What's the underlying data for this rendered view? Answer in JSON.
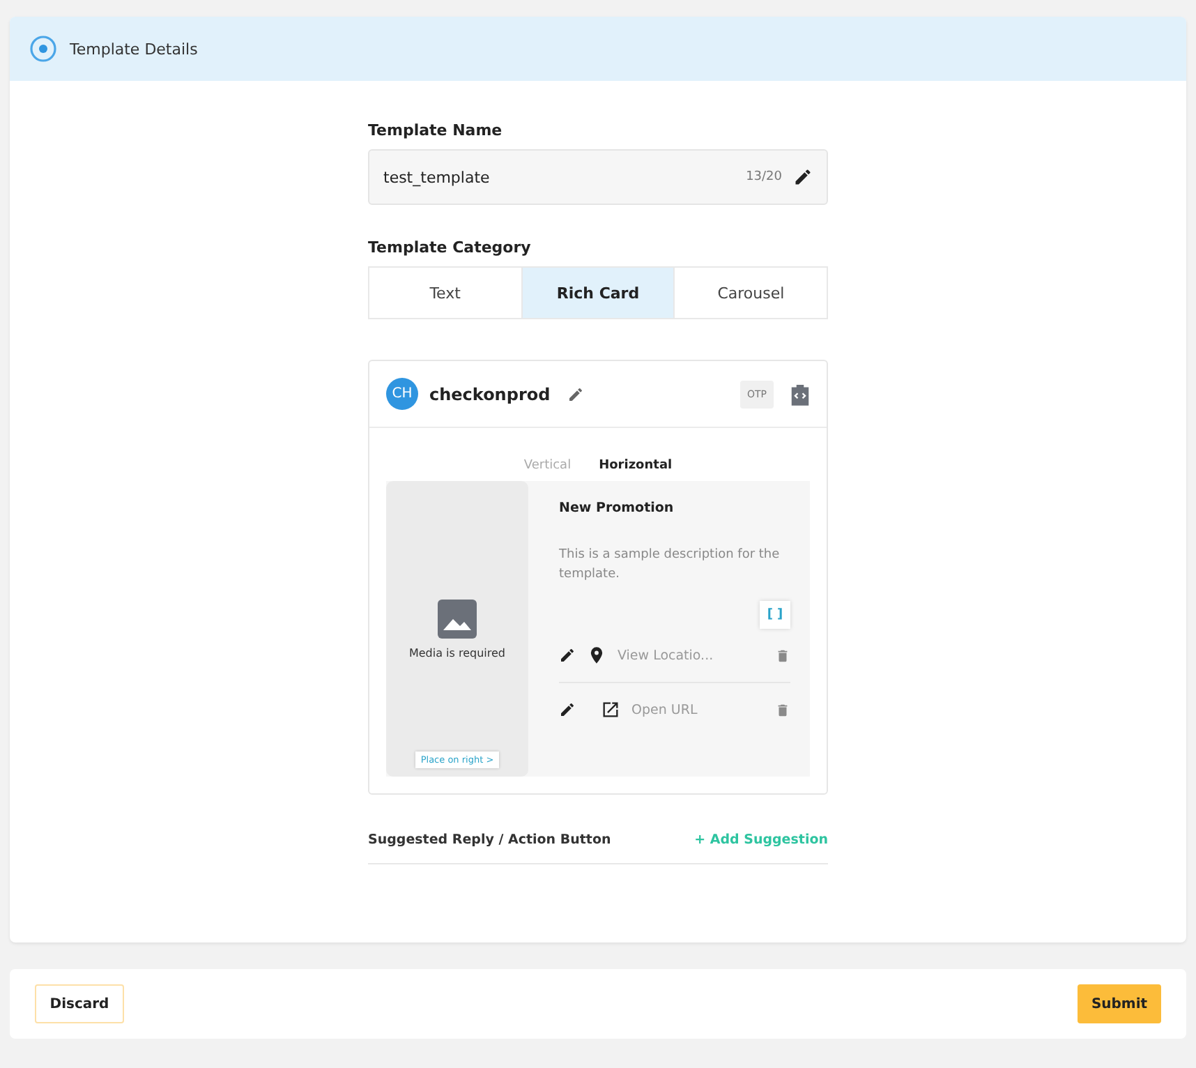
{
  "section": {
    "title": "Template Details"
  },
  "name_field": {
    "label": "Template Name",
    "value": "test_template",
    "counter": "13/20"
  },
  "category": {
    "label": "Template Category",
    "options": [
      {
        "label": "Text",
        "selected": false
      },
      {
        "label": "Rich Card",
        "selected": true
      },
      {
        "label": "Carousel",
        "selected": false
      }
    ]
  },
  "preview": {
    "avatar": "CH",
    "sender": "checkonprod",
    "badge": "OTP",
    "orientations": [
      {
        "label": "Vertical",
        "selected": false
      },
      {
        "label": "Horizontal",
        "selected": true
      }
    ],
    "media_text": "Media is required",
    "place_button": "Place on right >",
    "card_title": "New Promotion",
    "card_description": "This is a sample description for the template.",
    "variable_button": "[ ]",
    "actions": [
      {
        "kind": "location",
        "label": "View Locatio..."
      },
      {
        "kind": "url",
        "label": "Open URL"
      }
    ]
  },
  "suggestions": {
    "label": "Suggested Reply / Action Button",
    "add": "+ Add Suggestion"
  },
  "footer": {
    "discard": "Discard",
    "submit": "Submit"
  }
}
